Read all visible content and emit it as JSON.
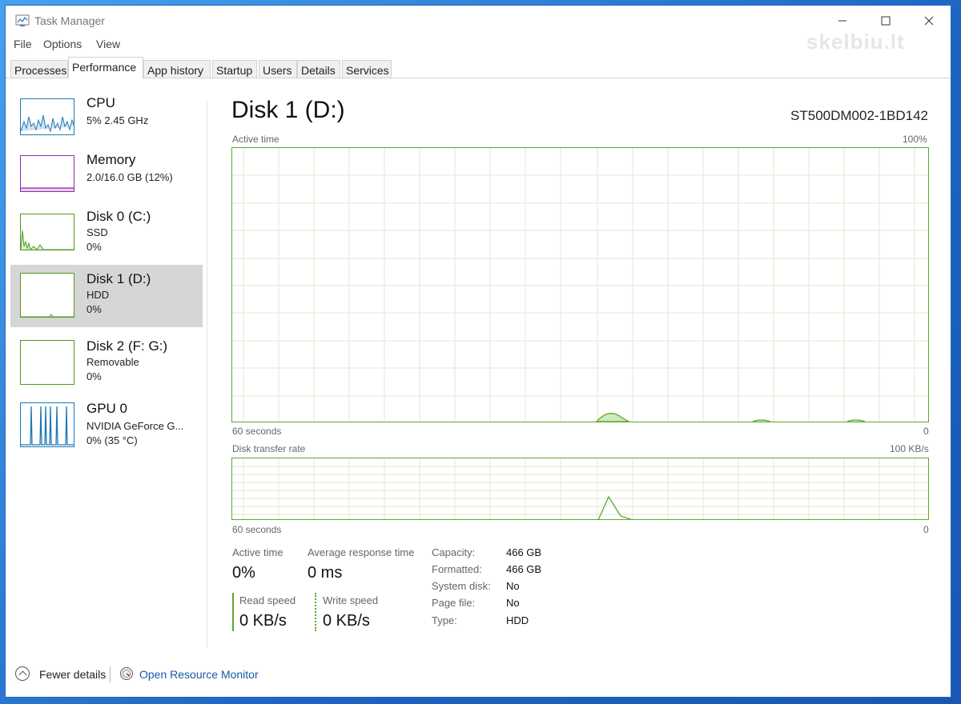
{
  "window": {
    "title": "Task Manager",
    "watermark": "skelbiu.lt"
  },
  "menu": [
    "File",
    "Options",
    "View"
  ],
  "tabs": [
    "Processes",
    "Performance",
    "App history",
    "Startup",
    "Users",
    "Details",
    "Services"
  ],
  "active_tab": "Performance",
  "sidebar": [
    {
      "title": "CPU",
      "line1": "5%  2.45 GHz",
      "line2": "",
      "color": "#1f78b4"
    },
    {
      "title": "Memory",
      "line1": "2.0/16.0 GB (12%)",
      "line2": "",
      "color": "#8b2fa3"
    },
    {
      "title": "Disk 0 (C:)",
      "line1": "SSD",
      "line2": "0%",
      "color": "#4f9a1c"
    },
    {
      "title": "Disk 1 (D:)",
      "line1": "HDD",
      "line2": "0%",
      "color": "#4f9a1c",
      "selected": true
    },
    {
      "title": "Disk 2 (F: G:)",
      "line1": "Removable",
      "line2": "0%",
      "color": "#4f9a1c"
    },
    {
      "title": "GPU 0",
      "line1": "NVIDIA GeForce G...",
      "line2": "0%  (35 °C)",
      "color": "#1f78b4"
    }
  ],
  "main": {
    "title": "Disk 1 (D:)",
    "model": "ST500DM002-1BD142",
    "active_graph": {
      "label": "Active time",
      "max": "100%",
      "x_left": "60 seconds",
      "x_right": "0"
    },
    "transfer_graph": {
      "label": "Disk transfer rate",
      "max": "100 KB/s",
      "x_left": "60 seconds",
      "x_right": "0"
    },
    "active_time": {
      "label": "Active time",
      "value": "0%"
    },
    "avg_response": {
      "label": "Average response time",
      "value": "0 ms"
    },
    "read_speed": {
      "label": "Read speed",
      "value": "0 KB/s"
    },
    "write_speed": {
      "label": "Write speed",
      "value": "0 KB/s"
    },
    "properties": [
      {
        "label": "Capacity:",
        "value": "466 GB"
      },
      {
        "label": "Formatted:",
        "value": "466 GB"
      },
      {
        "label": "System disk:",
        "value": "No"
      },
      {
        "label": "Page file:",
        "value": "No"
      },
      {
        "label": "Type:",
        "value": "HDD"
      }
    ]
  },
  "footer": {
    "fewer_details": "Fewer details",
    "resource_monitor": "Open Resource Monitor"
  },
  "colors": {
    "disk_green": "#5ea72f",
    "link_blue": "#1a57a6"
  }
}
